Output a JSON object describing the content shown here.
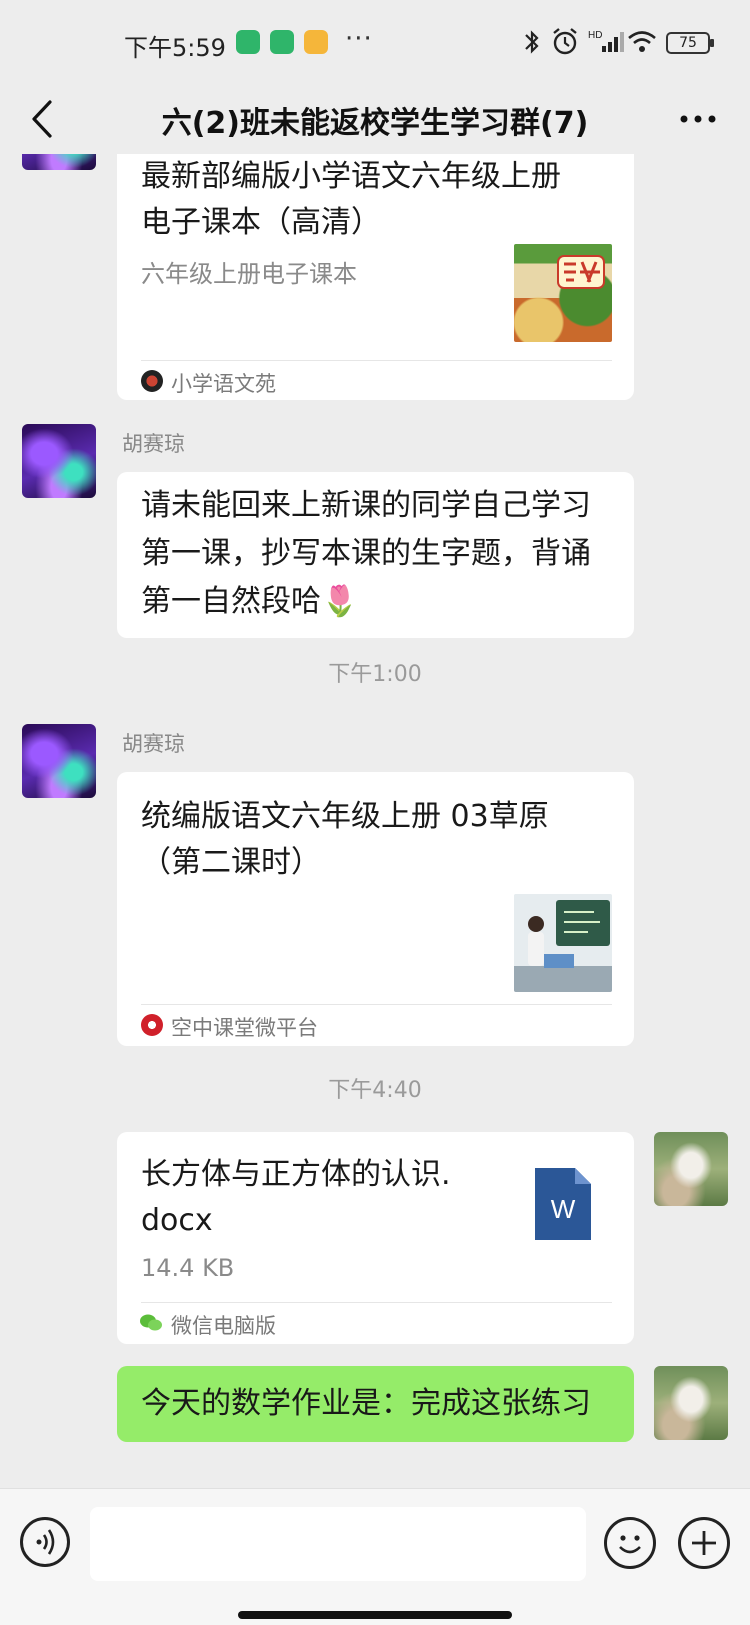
{
  "status_bar": {
    "time": "下午5:59",
    "dots": "···",
    "battery": "75",
    "app_icons": [
      "shield-app-icon",
      "shield-app-icon",
      "note-app-icon"
    ]
  },
  "header": {
    "title": "六(2)班未能返校学生学习群(7)"
  },
  "messages": [
    {
      "type": "link_card",
      "title_lines": [
        "最新部编版小学语文六年级上册",
        "电子课本（高清）"
      ],
      "description": "六年级上册电子课本",
      "source": "小学语文苑"
    },
    {
      "type": "text",
      "sender": "胡赛琼",
      "lines": [
        "请未能回来上新课的同学自己学习",
        "第一课，抄写本课的生字题，背诵",
        "第一自然段哈🌷"
      ]
    },
    {
      "type": "time",
      "text": "下午1:00"
    },
    {
      "type": "link_card",
      "sender": "胡赛琼",
      "title_lines": [
        "统编版语文六年级上册 03草原",
        "（第二课时）"
      ],
      "source": "空中课堂微平台"
    },
    {
      "type": "time",
      "text": "下午4:40"
    },
    {
      "type": "file_card",
      "file_name_lines": [
        "长方体与正方体的认识.",
        "docx"
      ],
      "file_size": "14.4 KB",
      "file_icon_letter": "W",
      "source": "微信电脑版"
    },
    {
      "type": "text_self",
      "text": "今天的数学作业是：完成这张练习"
    }
  ],
  "colors": {
    "background": "#ededed",
    "self_bubble": "#95ec69",
    "word_icon": "#2b5797"
  }
}
